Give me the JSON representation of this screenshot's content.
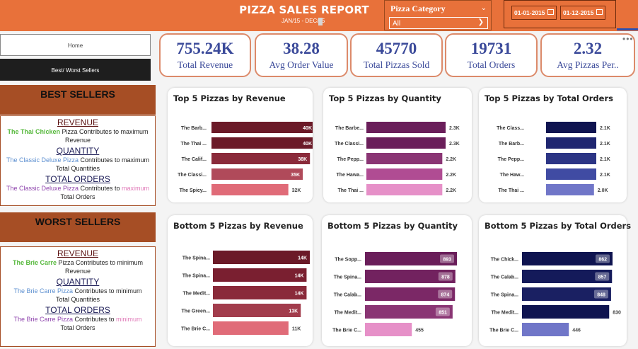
{
  "header": {
    "title": "PIZZA SALES REPORT",
    "subtitle": "JAN/15 - DEC/15",
    "category_label": "Pizza Category",
    "category_value": "All",
    "date_start": "01-01-2015",
    "date_end": "01-12-2015"
  },
  "nav": {
    "home": "Home",
    "best_worst": "Best/ Worst Sellers"
  },
  "best": {
    "heading": "BEST SELLERS",
    "revenue_title": "REVENUE",
    "revenue_name": "The Thai Chicken",
    "revenue_text1": " Pizza Contributes to maximum",
    "revenue_text2": "Revenue",
    "quantity_title": "QUANTITY",
    "quantity_name": "The Classic Deluxe Pizza",
    "quantity_text1": " Contributes to maximum",
    "quantity_text2": "Total Quantities",
    "orders_title": "TOTAL ORDERS",
    "orders_name": "The Classic Deluxe Pizza",
    "orders_text1": " Contributes to ",
    "orders_word": "maximum",
    "orders_text2": "Total Orders"
  },
  "worst": {
    "heading": "WORST SELLERS",
    "revenue_title": "REVENUE",
    "revenue_name": "The Brie Carre",
    "revenue_text1": " Pizza Contributes to minimum",
    "revenue_text2": "Revenue",
    "quantity_title": "QUANTITY",
    "quantity_name": "The Brie Carre Pizza",
    "quantity_text1": " Contributes to minimum",
    "quantity_text2": "Total Quantities",
    "orders_title": "TOTAL ORDERS",
    "orders_name": "The Brie Carre Pizza",
    "orders_text1": " Contributes to ",
    "orders_word": "minimum",
    "orders_text2": "Total Orders"
  },
  "kpis": [
    {
      "value": "755.24K",
      "label": "Total Revenue"
    },
    {
      "value": "38.28",
      "label": "Avg Order Value"
    },
    {
      "value": "45770",
      "label": "Total Pizzas Sold"
    },
    {
      "value": "19731",
      "label": "Total Orders"
    },
    {
      "value": "2.32",
      "label": "Avg Pizzas Per.."
    }
  ],
  "more_icon": "ellipsis-icon",
  "chart_data": [
    {
      "type": "bar",
      "orientation": "horizontal",
      "title": "Top 5 Pizzas by Revenue",
      "categories": [
        "The Barb...",
        "The Thai ...",
        "The Calif...",
        "The Classi...",
        "The Spicy..."
      ],
      "values": [
        43000,
        43000,
        41000,
        38000,
        32000
      ],
      "labels": [
        "40K",
        "40K",
        "38K",
        "35K",
        "32K"
      ],
      "colors": [
        "#6b1a28",
        "#6b1a28",
        "#8a2a3a",
        "#b04a5a",
        "#e06b78"
      ]
    },
    {
      "type": "bar",
      "orientation": "horizontal",
      "title": "Top 5 Pizzas by Quantity",
      "categories": [
        "The Barbe...",
        "The Classi...",
        "The Pepp...",
        "The Hawa...",
        "The Thai ..."
      ],
      "values": [
        2400,
        2400,
        2300,
        2300,
        2300
      ],
      "labels": [
        "2.3K",
        "2.3K",
        "2.2K",
        "2.2K",
        "2.2K"
      ],
      "colors": [
        "#6a1e5a",
        "#6a1e5a",
        "#8a3574",
        "#b04c93",
        "#e690c8"
      ]
    },
    {
      "type": "bar",
      "orientation": "horizontal",
      "title": "Top 5 Pizzas by Total Orders",
      "categories": [
        "The Class...",
        "The Barb...",
        "The Pepp...",
        "The Haw...",
        "The Thai ..."
      ],
      "values": [
        2200,
        2200,
        2200,
        2200,
        2100
      ],
      "labels": [
        "2.1K",
        "2.1K",
        "2.1K",
        "2.1K",
        "2.0K"
      ],
      "colors": [
        "#0f1450",
        "#1f2670",
        "#2c3585",
        "#404ba3",
        "#7076c8"
      ]
    },
    {
      "type": "bar",
      "orientation": "horizontal",
      "title": "Bottom 5 Pizzas by Revenue",
      "categories": [
        "The Spina...",
        "The Spina...",
        "The Medit...",
        "The Green...",
        "The Brie C..."
      ],
      "values": [
        15000,
        14500,
        14500,
        13600,
        11700
      ],
      "labels": [
        "14K",
        "14K",
        "14K",
        "13K",
        "11K"
      ],
      "colors": [
        "#6b1a28",
        "#7a1f30",
        "#8a2a3a",
        "#a23c4c",
        "#e06b78"
      ]
    },
    {
      "type": "bar",
      "orientation": "horizontal",
      "title": "Bottom 5 Pizzas by Quantity",
      "categories": [
        "The Sopp...",
        "The Spina...",
        "The Calab...",
        "The Medit...",
        "The Brie C..."
      ],
      "values": [
        893,
        878,
        874,
        851,
        455
      ],
      "labels": [
        "893",
        "878",
        "874",
        "851",
        "455"
      ],
      "colors": [
        "#6a1e5a",
        "#72225f",
        "#7b2866",
        "#8a3574",
        "#e690c8"
      ]
    },
    {
      "type": "bar",
      "orientation": "horizontal",
      "title": "Bottom 5 Pizzas by Total Orders",
      "categories": [
        "The Chick...",
        "The Calab...",
        "The Spina...",
        "The Medit...",
        "The Brie C..."
      ],
      "values": [
        862,
        857,
        848,
        830,
        446
      ],
      "labels": [
        "862",
        "857",
        "848",
        "830",
        "446"
      ],
      "colors": [
        "#0f1450",
        "#141a5a",
        "#1a2062",
        "#0f1450",
        "#7076c8"
      ]
    }
  ]
}
